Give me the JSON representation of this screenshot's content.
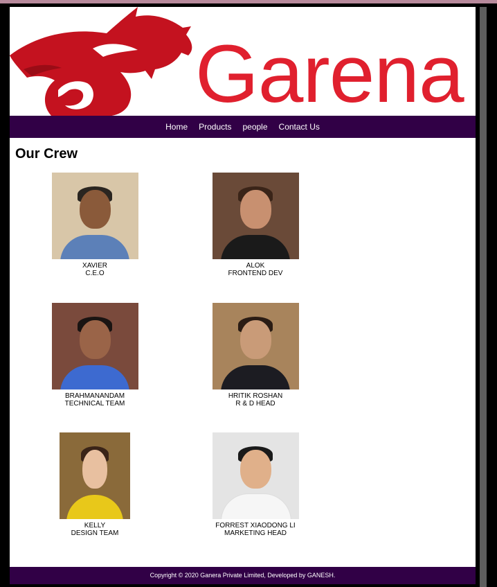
{
  "brand": {
    "logo_text": "Garena",
    "logo_color": "#e0202e"
  },
  "nav": [
    {
      "label": "Home"
    },
    {
      "label": "Products"
    },
    {
      "label": "people"
    },
    {
      "label": "Contact Us"
    }
  ],
  "section_title": "Our Crew",
  "crew": [
    {
      "name": "XAVIER",
      "role": "C.E.O"
    },
    {
      "name": "ALOK",
      "role": "FRONTEND DEV"
    },
    {
      "name": "BRAHMANANDAM",
      "role": "TECHNICAL TEAM"
    },
    {
      "name": "HRITIK ROSHAN",
      "role": "R & D HEAD"
    },
    {
      "name": "KELLY",
      "role": "DESIGN TEAM"
    },
    {
      "name": "FORREST XIAODONG LI",
      "role": "MARKETING HEAD"
    }
  ],
  "footer": {
    "text": "Copyright © 2020 Ganera Private Limited, Developed by GANESH."
  },
  "colors": {
    "nav_bg": "#310046",
    "accent_red": "#e0202e"
  }
}
